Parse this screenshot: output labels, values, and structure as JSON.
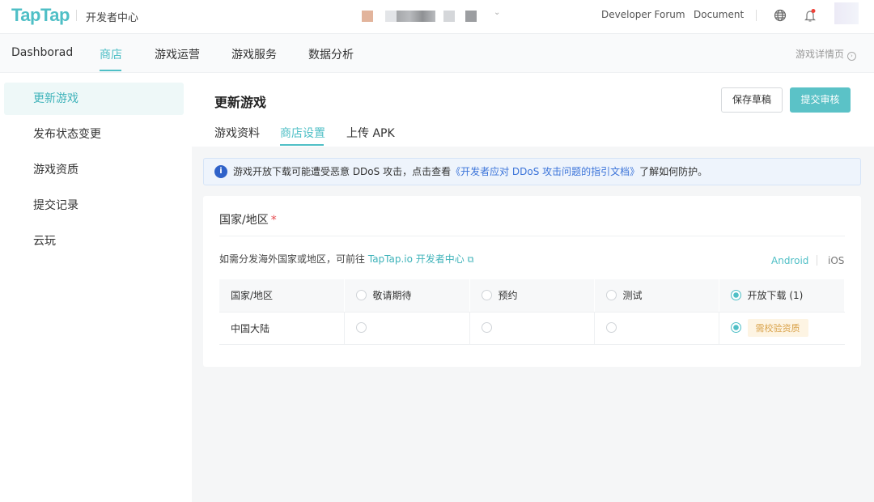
{
  "header": {
    "logo": "TapTap",
    "subtitle": "开发者中心",
    "links": [
      "Developer Forum",
      "Document"
    ]
  },
  "subnav": {
    "items": [
      "Dashborad",
      "商店",
      "游戏运营",
      "游戏服务",
      "数据分析"
    ],
    "right_link": "游戏详情页"
  },
  "sidebar": {
    "items": [
      "更新游戏",
      "发布状态变更",
      "游戏资质",
      "提交记录",
      "云玩"
    ]
  },
  "main": {
    "title": "更新游戏",
    "save_draft": "保存草稿",
    "submit": "提交审核",
    "tabs": [
      "游戏资料",
      "商店设置",
      "上传 APK"
    ]
  },
  "alert": {
    "text": "游戏开放下载可能遭受恶意 DDoS 攻击，点击查看",
    "link": "《开发者应对 DDoS 攻击问题的指引文档》",
    "suffix": "了解如何防护。"
  },
  "region": {
    "label": "国家/地区",
    "required": "*",
    "hint": "如需分发海外国家或地区，可前往",
    "hint_link": "TapTap.io 开发者中心",
    "platforms": [
      "Android",
      "iOS"
    ],
    "columns": [
      "国家/地区",
      "敬请期待",
      "预约",
      "测试",
      "开放下载 (1)"
    ],
    "rows": [
      {
        "name": "中国大陆",
        "tag": "需校验资质"
      }
    ]
  },
  "colors": {
    "accent": "#4fbfc6",
    "submit": "#5bc2c7"
  }
}
